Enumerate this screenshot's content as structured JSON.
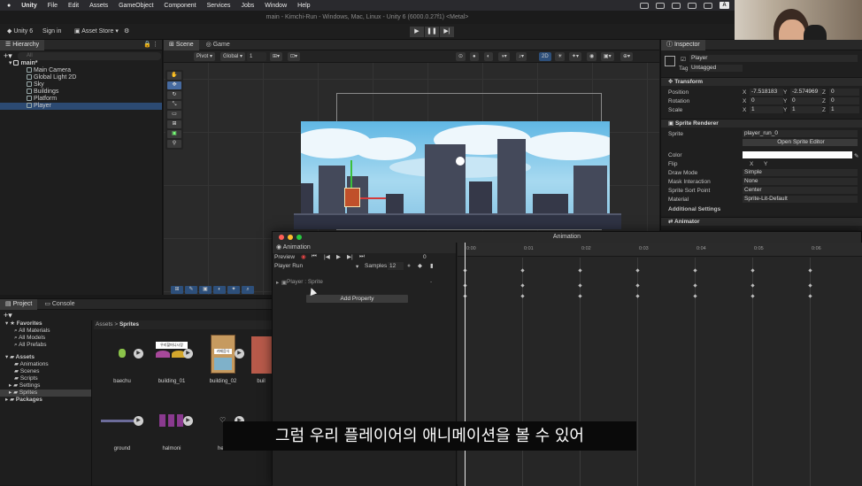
{
  "menubar": {
    "items": [
      "Unity",
      "File",
      "Edit",
      "Assets",
      "GameObject",
      "Component",
      "Services",
      "Jobs",
      "Window",
      "Help"
    ],
    "badge": "A"
  },
  "window_title": "main - Kimchi-Run - Windows, Mac, Linux - Unity 6 (6000.0.27f1) <Metal>",
  "toolbar": {
    "account": "Unity 6",
    "sign_in": "Sign in",
    "asset_store": "Asset Store ▾"
  },
  "hierarchy": {
    "tab": "Hierarchy",
    "search_placeholder": "All",
    "scene": "main*",
    "items": [
      "Main Camera",
      "Global Light 2D",
      "Sky",
      "Buildings",
      "Platform",
      "Player"
    ]
  },
  "scene_view": {
    "tabs": [
      "Scene",
      "Game"
    ],
    "pivot": "Pivot",
    "global": "Global",
    "grid_value": "1",
    "mode_2d": "2D"
  },
  "inspector": {
    "tab": "Inspector",
    "object_name": "Player",
    "tag_label": "Tag",
    "tag_value": "Untagged",
    "transform": {
      "title": "Transform",
      "position_label": "Position",
      "rotation_label": "Rotation",
      "scale_label": "Scale",
      "position": [
        "-7.518183",
        "-2.574969",
        "0"
      ],
      "rotation": [
        "0",
        "0",
        "0"
      ],
      "scale": [
        "1",
        "1",
        "1"
      ],
      "axes": [
        "X",
        "Y",
        "Z"
      ]
    },
    "sprite_renderer": {
      "title": "Sprite Renderer",
      "sprite_label": "Sprite",
      "sprite_value": "player_run_0",
      "open_editor": "Open Sprite Editor",
      "color_label": "Color",
      "flip_label": "Flip",
      "flip_x": "X",
      "flip_y": "Y",
      "draw_mode_label": "Draw Mode",
      "draw_mode": "Simple",
      "mask_label": "Mask Interaction",
      "mask": "None",
      "sort_point_label": "Sprite Sort Point",
      "sort_point": "Center",
      "material_label": "Material",
      "material": "Sprite-Lit-Default",
      "additional": "Additional Settings"
    },
    "animator": "Animator"
  },
  "project": {
    "tabs": [
      "Project",
      "Console"
    ],
    "favorites": "Favorites",
    "fav_items": [
      "All Materials",
      "All Models",
      "All Prefabs"
    ],
    "assets": "Assets",
    "folders": [
      "Animations",
      "Scenes",
      "Scripts",
      "Settings",
      "Sprites"
    ],
    "packages": "Packages",
    "breadcrumb": [
      "Assets",
      ">",
      "Sprites"
    ],
    "files": [
      "baechu",
      "building_01",
      "building_02",
      "buil",
      "ground",
      "halmoni",
      "hear"
    ],
    "sign_text": "우리할머니시장",
    "building_sign": "카페음식"
  },
  "animation": {
    "title": "Animation",
    "tab": "Animation",
    "preview": "Preview",
    "frame": "0",
    "clip": "Player Run",
    "samples_label": "Samples",
    "samples": "12",
    "property": "Player : Sprite",
    "add_property": "Add Property",
    "timecodes": [
      "0:00",
      "0:01",
      "0:02",
      "0:03",
      "0:04",
      "0:05",
      "0:06"
    ]
  },
  "subtitle": "그럼 우리 플레이어의 애니메이션을 볼 수 있어",
  "colors": {
    "selection": "#2c4a72",
    "sky": "#60b7e4",
    "player": "#c0502a"
  }
}
